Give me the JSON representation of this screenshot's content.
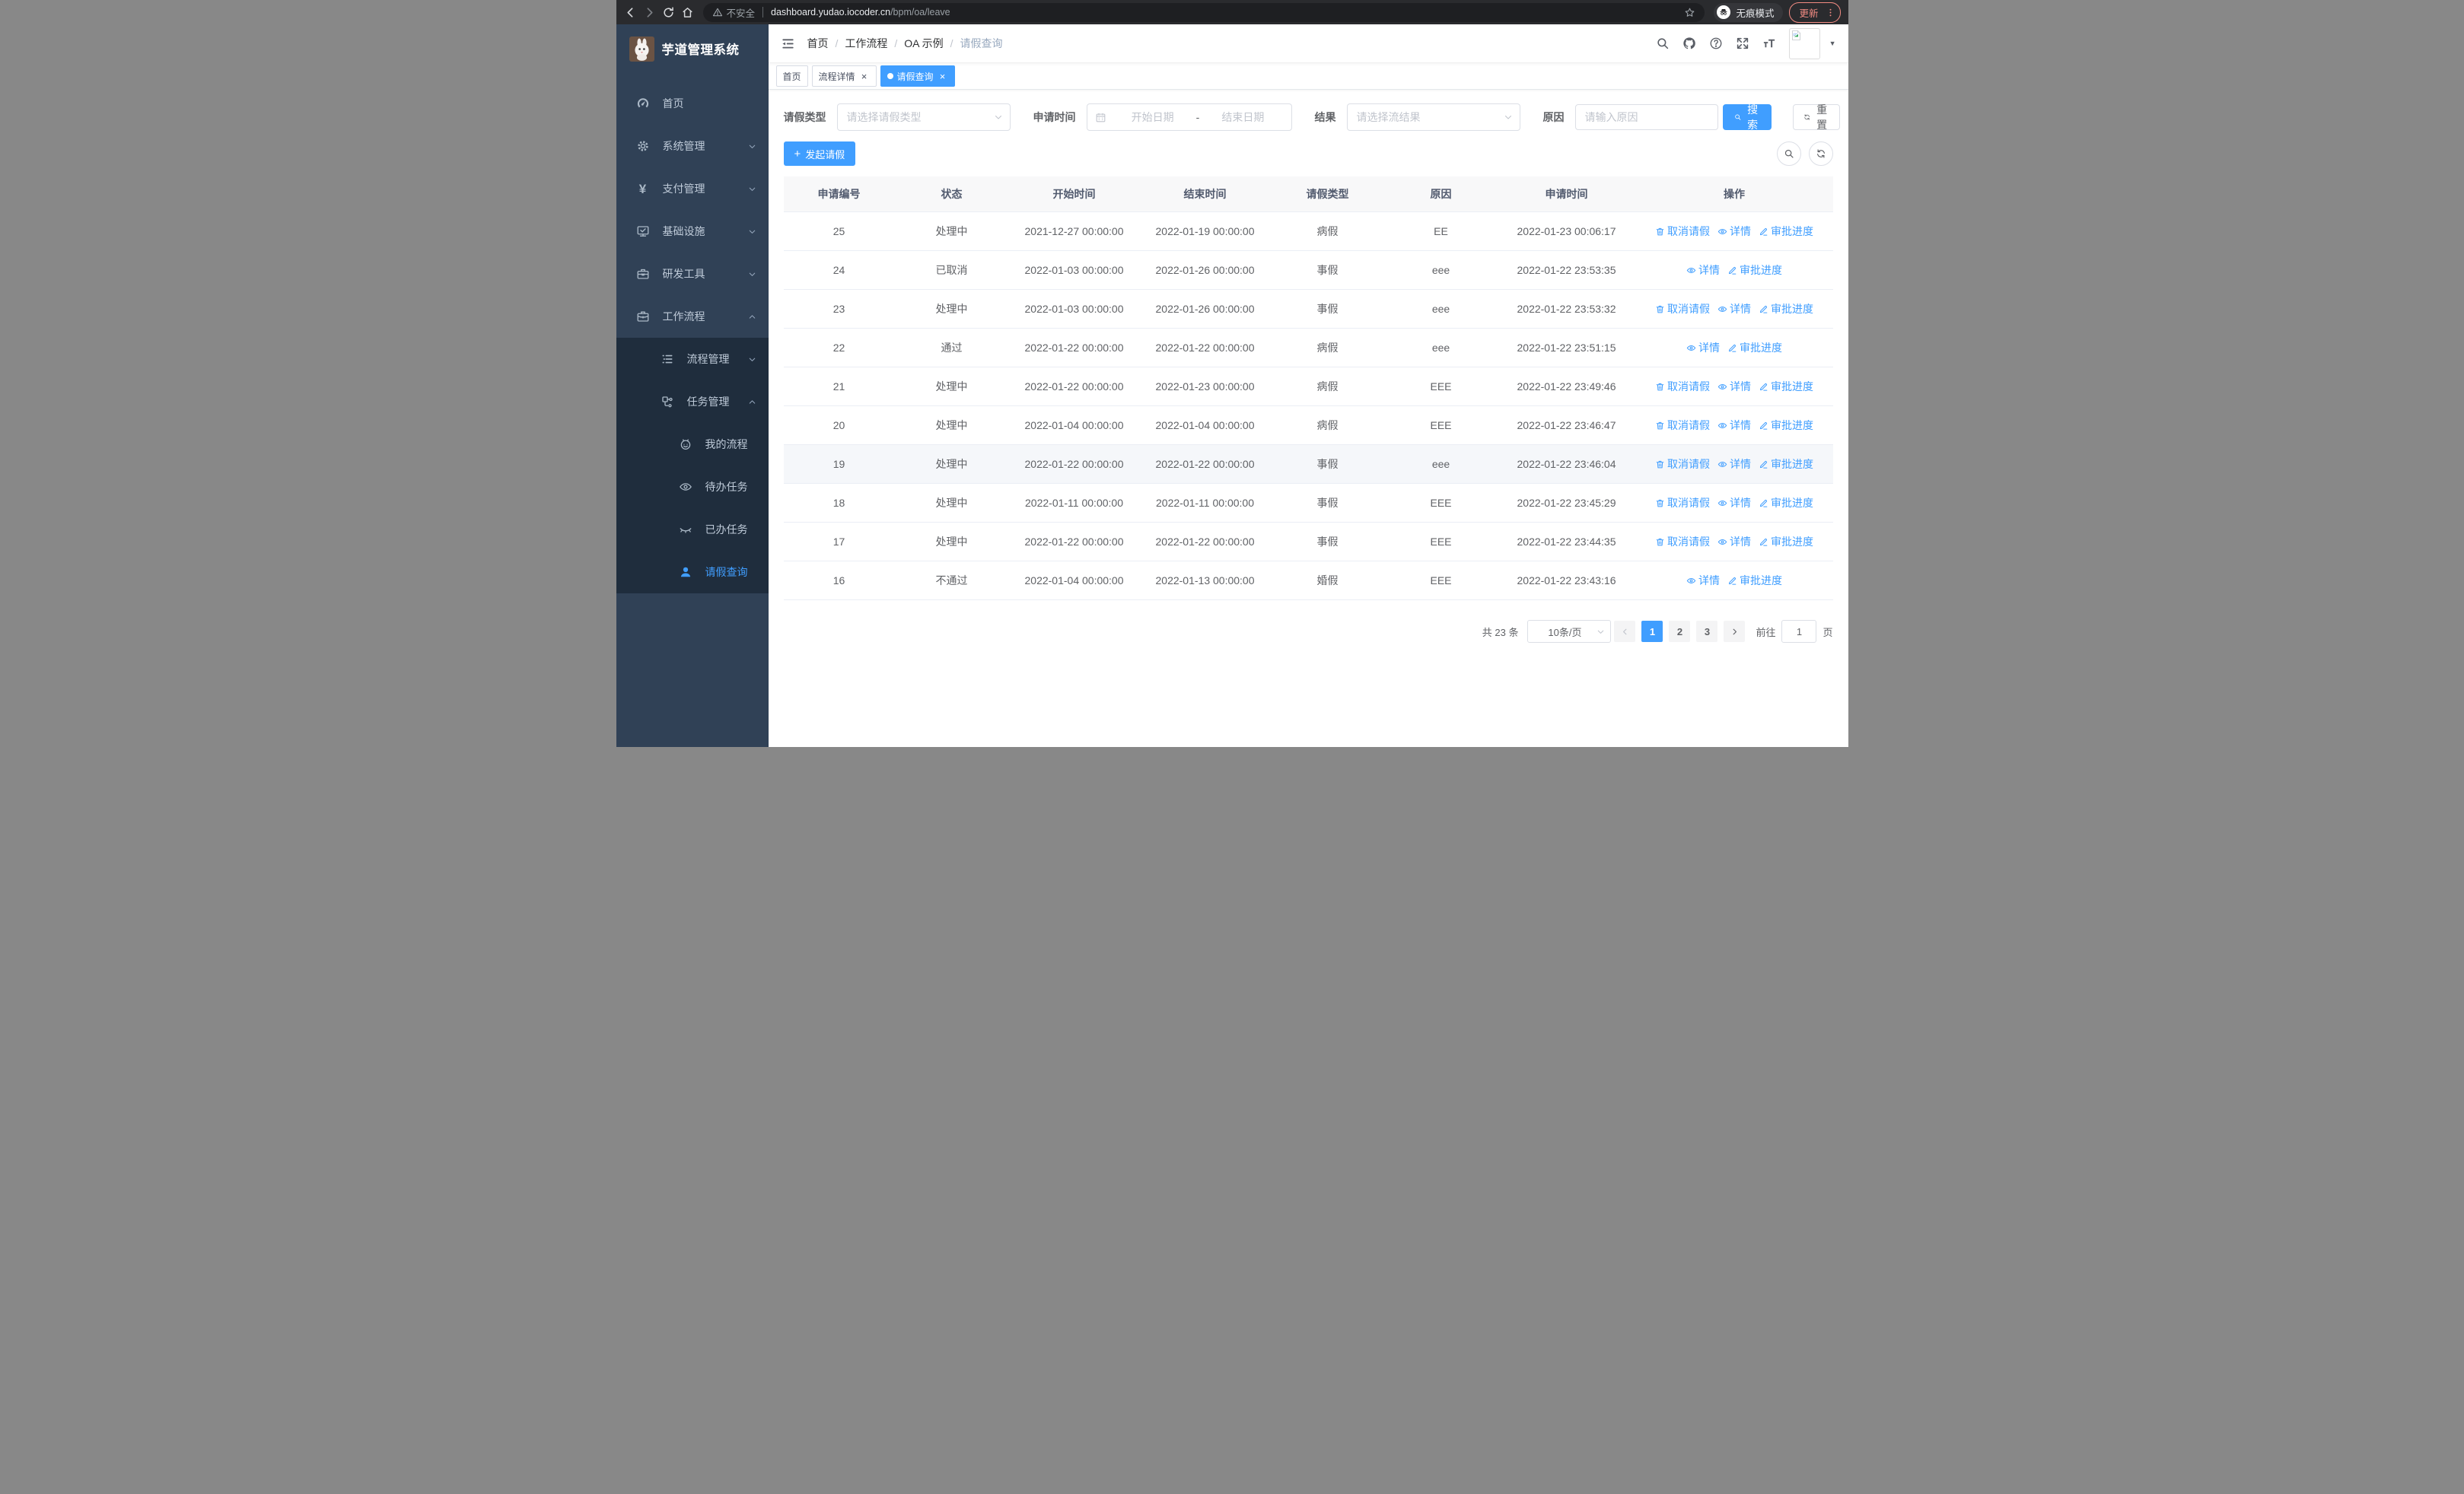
{
  "colors": {
    "primary": "#409eff",
    "sidebar_bg": "#304156",
    "submenu_bg": "#1f2d3d",
    "table_header_bg": "#f8f8f9",
    "update_chip": "#f28b82"
  },
  "browser": {
    "security_text": "不安全",
    "url_host": "dashboard.yudao.iocoder.cn",
    "url_path": "/bpm/oa/leave",
    "incognito_text": "无痕模式",
    "update_text": "更新"
  },
  "sidebar": {
    "logo_title": "芋道管理系统",
    "items": [
      {
        "name": "home",
        "icon": "gauge-icon",
        "label": "首页",
        "level": 1
      },
      {
        "name": "system-mgmt",
        "icon": "gear-icon",
        "label": "系统管理",
        "level": 1,
        "chevron": "down"
      },
      {
        "name": "payment-mgmt",
        "icon": "yen-icon",
        "label": "支付管理",
        "level": 1,
        "chevron": "down"
      },
      {
        "name": "infrastructure",
        "icon": "monitor-icon",
        "label": "基础设施",
        "level": 1,
        "chevron": "down"
      },
      {
        "name": "dev-tools",
        "icon": "toolbox-icon",
        "label": "研发工具",
        "level": 1,
        "chevron": "down"
      },
      {
        "name": "workflow",
        "icon": "briefcase-icon",
        "label": "工作流程",
        "level": 1,
        "chevron": "up"
      },
      {
        "name": "process-mgmt",
        "icon": "list-icon",
        "label": "流程管理",
        "level": 2,
        "chevron": "down",
        "dark": true
      },
      {
        "name": "task-mgmt",
        "icon": "flow-icon",
        "label": "任务管理",
        "level": 2,
        "chevron": "up",
        "dark": true
      },
      {
        "name": "my-process",
        "icon": "robot-face-icon",
        "label": "我的流程",
        "level": 3,
        "dark": true
      },
      {
        "name": "todo-tasks",
        "icon": "eye-icon",
        "label": "待办任务",
        "level": 3,
        "dark": true
      },
      {
        "name": "done-tasks",
        "icon": "eye-closed-icon",
        "label": "已办任务",
        "level": 3,
        "dark": true
      },
      {
        "name": "leave-query",
        "icon": "user-icon",
        "label": "请假查询",
        "level": 3,
        "dark": true,
        "active": true
      }
    ]
  },
  "header": {
    "breadcrumb": [
      "首页",
      "工作流程",
      "OA 示例",
      "请假查询"
    ],
    "navbar_icons": [
      "search-icon",
      "github-icon",
      "help-icon",
      "fullscreen-icon",
      "font-size-icon"
    ]
  },
  "tags": [
    {
      "name": "tag-home",
      "label": "首页",
      "closable": false,
      "active": false
    },
    {
      "name": "tag-process-detail",
      "label": "流程详情",
      "closable": true,
      "active": false
    },
    {
      "name": "tag-leave-query",
      "label": "请假查询",
      "closable": true,
      "active": true
    }
  ],
  "filters": {
    "leave_type_label": "请假类型",
    "leave_type_placeholder": "请选择请假类型",
    "apply_time_label": "申请时间",
    "start_date_placeholder": "开始日期",
    "range_separator": "-",
    "end_date_placeholder": "结束日期",
    "result_label": "结果",
    "result_placeholder": "请选择流结果",
    "reason_label": "原因",
    "reason_placeholder": "请输入原因",
    "search_label": "搜索",
    "reset_label": "重置"
  },
  "toolbar": {
    "create_label": "发起请假"
  },
  "table": {
    "columns": [
      "申请编号",
      "状态",
      "开始时间",
      "结束时间",
      "请假类型",
      "原因",
      "申请时间",
      "操作"
    ],
    "action_labels": {
      "cancel": "取消请假",
      "detail": "详情",
      "progress": "审批进度"
    },
    "rows": [
      {
        "id": "25",
        "status": "处理中",
        "start": "2021-12-27 00:00:00",
        "end": "2022-01-19 00:00:00",
        "type": "病假",
        "reason": "EE",
        "apply_time": "2022-01-23 00:06:17",
        "actions": [
          "cancel",
          "detail",
          "progress"
        ],
        "highlight": false
      },
      {
        "id": "24",
        "status": "已取消",
        "start": "2022-01-03 00:00:00",
        "end": "2022-01-26 00:00:00",
        "type": "事假",
        "reason": "eee",
        "apply_time": "2022-01-22 23:53:35",
        "actions": [
          "detail",
          "progress"
        ],
        "highlight": false
      },
      {
        "id": "23",
        "status": "处理中",
        "start": "2022-01-03 00:00:00",
        "end": "2022-01-26 00:00:00",
        "type": "事假",
        "reason": "eee",
        "apply_time": "2022-01-22 23:53:32",
        "actions": [
          "cancel",
          "detail",
          "progress"
        ],
        "highlight": false
      },
      {
        "id": "22",
        "status": "通过",
        "start": "2022-01-22 00:00:00",
        "end": "2022-01-22 00:00:00",
        "type": "病假",
        "reason": "eee",
        "apply_time": "2022-01-22 23:51:15",
        "actions": [
          "detail",
          "progress"
        ],
        "highlight": false
      },
      {
        "id": "21",
        "status": "处理中",
        "start": "2022-01-22 00:00:00",
        "end": "2022-01-23 00:00:00",
        "type": "病假",
        "reason": "EEE",
        "apply_time": "2022-01-22 23:49:46",
        "actions": [
          "cancel",
          "detail",
          "progress"
        ],
        "highlight": false
      },
      {
        "id": "20",
        "status": "处理中",
        "start": "2022-01-04 00:00:00",
        "end": "2022-01-04 00:00:00",
        "type": "病假",
        "reason": "EEE",
        "apply_time": "2022-01-22 23:46:47",
        "actions": [
          "cancel",
          "detail",
          "progress"
        ],
        "highlight": false
      },
      {
        "id": "19",
        "status": "处理中",
        "start": "2022-01-22 00:00:00",
        "end": "2022-01-22 00:00:00",
        "type": "事假",
        "reason": "eee",
        "apply_time": "2022-01-22 23:46:04",
        "actions": [
          "cancel",
          "detail",
          "progress"
        ],
        "highlight": true
      },
      {
        "id": "18",
        "status": "处理中",
        "start": "2022-01-11 00:00:00",
        "end": "2022-01-11 00:00:00",
        "type": "事假",
        "reason": "EEE",
        "apply_time": "2022-01-22 23:45:29",
        "actions": [
          "cancel",
          "detail",
          "progress"
        ],
        "highlight": false
      },
      {
        "id": "17",
        "status": "处理中",
        "start": "2022-01-22 00:00:00",
        "end": "2022-01-22 00:00:00",
        "type": "事假",
        "reason": "EEE",
        "apply_time": "2022-01-22 23:44:35",
        "actions": [
          "cancel",
          "detail",
          "progress"
        ],
        "highlight": false
      },
      {
        "id": "16",
        "status": "不通过",
        "start": "2022-01-04 00:00:00",
        "end": "2022-01-13 00:00:00",
        "type": "婚假",
        "reason": "EEE",
        "apply_time": "2022-01-22 23:43:16",
        "actions": [
          "detail",
          "progress"
        ],
        "highlight": false
      }
    ]
  },
  "pagination": {
    "total": "共 23 条",
    "page_size": "10条/页",
    "pages": [
      "1",
      "2",
      "3"
    ],
    "active_page": "1",
    "goto_label": "前往",
    "goto_value": "1",
    "page_unit": "页"
  }
}
